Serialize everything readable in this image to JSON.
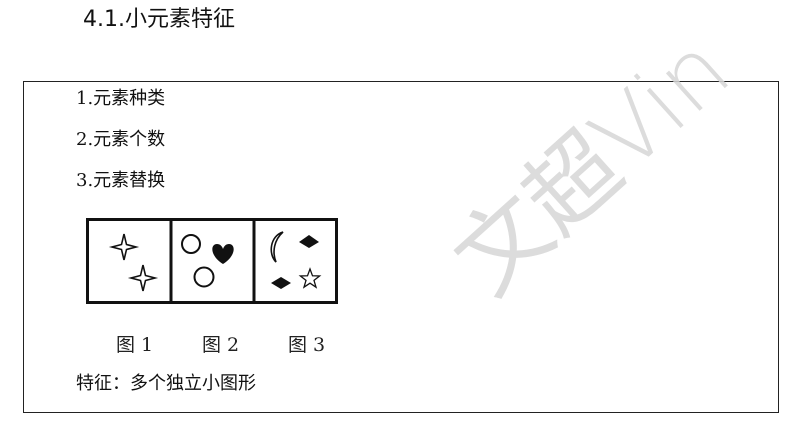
{
  "heading": "4.1.小元素特征",
  "items": [
    "1.元素种类",
    "2.元素个数",
    "3.元素替换"
  ],
  "figures": [
    {
      "caption": "图 1",
      "icons": [
        "four-point-star-icon",
        "four-point-star-icon"
      ]
    },
    {
      "caption": "图 2",
      "icons": [
        "circle-icon",
        "heart-icon",
        "circle-icon"
      ]
    },
    {
      "caption": "图 3",
      "icons": [
        "crescent-moon-icon",
        "diamond-icon",
        "diamond-icon",
        "outline-star-icon"
      ]
    }
  ],
  "feature": "特征：多个独立小图形",
  "watermark": "文超Vin"
}
